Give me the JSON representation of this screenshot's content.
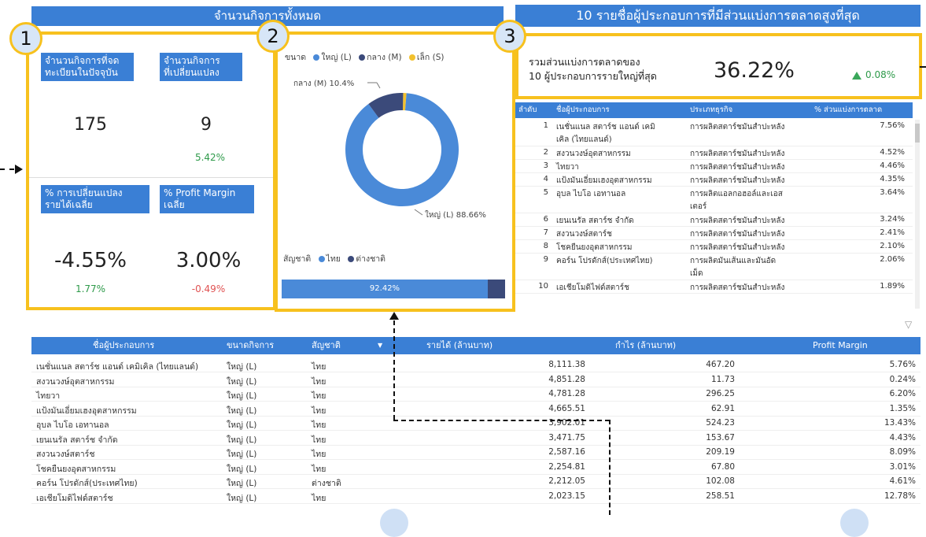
{
  "panel1": {
    "header": "จำนวนกิจการทั้งหมด",
    "kpi_registered_label": "จำนวนกิจการที่จด\nทะเบียนในปัจจุบัน",
    "kpi_registered_value": "175",
    "kpi_changed_label": "จำนวนกิจการ\nที่เปลี่ยนแปลง",
    "kpi_changed_value": "9",
    "kpi_changed_sub": "5.42%",
    "kpi_revchange_label": "% การเปลี่ยนแปลง\nรายได้เฉลี่ย",
    "kpi_revchange_value": "-4.55%",
    "kpi_revchange_sub": "1.77%",
    "kpi_margin_label": "% Profit Margin\nเฉลี่ย",
    "kpi_margin_value": "3.00%",
    "kpi_margin_sub": "-0.49%"
  },
  "panel2": {
    "size_legend_title": "ขนาด",
    "size_legend": [
      {
        "label": "ใหญ่ (L)",
        "color": "#4a8ad8"
      },
      {
        "label": "กลาง (M)",
        "color": "#3b4a7a"
      },
      {
        "label": "เล็ก (S)",
        "color": "#f2c12e"
      }
    ],
    "donut_label_m": "กลาง (M) 10.4%",
    "donut_label_l": "ใหญ่ (L) 88.66%",
    "nation_legend_title": "สัญชาติ",
    "nation_legend": [
      {
        "label": "ไทย",
        "color": "#4a8ad8"
      },
      {
        "label": "ต่างชาติ",
        "color": "#3b4a7a"
      }
    ],
    "bar_label": "92.42%"
  },
  "chart_data": [
    {
      "type": "pie",
      "categories": [
        "ใหญ่ (L)",
        "กลาง (M)",
        "เล็ก (S)"
      ],
      "values": [
        88.66,
        10.4,
        0.94
      ]
    },
    {
      "type": "bar",
      "categories": [
        "ไทย",
        "ต่างชาติ"
      ],
      "values": [
        92.42,
        7.58
      ]
    }
  ],
  "panel3": {
    "header": "10 รายชื่อผู้ประกอบการที่มีส่วนแบ่งการตลาดสูงที่สุด",
    "total_label": "รวมส่วนแบ่งการตลาดของ\n10 ผู้ประกอบการรายใหญ่ที่สุด",
    "total_value": "36.22%",
    "total_delta": "0.08%",
    "columns": [
      "ลำดับ",
      "ชื่อผู้ประกอบการ",
      "ประเภทธุรกิจ",
      "% ส่วนแบ่งการตลาด"
    ],
    "rows": [
      {
        "rank": "1",
        "name": "เนชั่นแนล สตาร์ช แอนด์ เคมิ",
        "name2": "เคิล (ไทยแลนด์)",
        "type": "การผลิตสตาร์ชมันสำปะหลัง",
        "type2": "",
        "share": "7.56%"
      },
      {
        "rank": "2",
        "name": "สงวนวงษ์อุตสาหกรรม",
        "name2": "",
        "type": "การผลิตสตาร์ชมันสำปะหลัง",
        "type2": "",
        "share": "4.52%"
      },
      {
        "rank": "3",
        "name": "ไทยวา",
        "name2": "",
        "type": "การผลิตสตาร์ชมันสำปะหลัง",
        "type2": "",
        "share": "4.46%"
      },
      {
        "rank": "4",
        "name": "แป้งมันเอี่ยมเฮงอุตสาหกรรม",
        "name2": "",
        "type": "การผลิตสตาร์ชมันสำปะหลัง",
        "type2": "",
        "share": "4.35%"
      },
      {
        "rank": "5",
        "name": "อุบล ไบโอ เอทานอล",
        "name2": "",
        "type": "การผลิตแอลกอฮอล์และเอส",
        "type2": "เตอร์",
        "share": "3.64%"
      },
      {
        "rank": "6",
        "name": "เยนเนรัล สตาร์ช จำกัด",
        "name2": "",
        "type": "การผลิตสตาร์ชมันสำปะหลัง",
        "type2": "",
        "share": "3.24%"
      },
      {
        "rank": "7",
        "name": "สงวนวงษ์สตาร์ช",
        "name2": "",
        "type": "การผลิตสตาร์ชมันสำปะหลัง",
        "type2": "",
        "share": "2.41%"
      },
      {
        "rank": "8",
        "name": "โชคยืนยงอุตสาหกรรม",
        "name2": "",
        "type": "การผลิตสตาร์ชมันสำปะหลัง",
        "type2": "",
        "share": "2.10%"
      },
      {
        "rank": "9",
        "name": "คอร์น โปรดักส์(ประเทศไทย)",
        "name2": "",
        "type": "การผลิตมันเส้นและมันอัด",
        "type2": "เม็ด",
        "share": "2.06%"
      },
      {
        "rank": "10",
        "name": "เอเชียโมดิไฟด์สตาร์ช",
        "name2": "",
        "type": "การผลิตสตาร์ชมันสำปะหลัง",
        "type2": "",
        "share": "1.89%"
      }
    ]
  },
  "bottom_table": {
    "columns": [
      "ชื่อผู้ประกอบการ",
      "ขนาดกิจการ",
      "สัญชาติ",
      "รายได้ (ล้านบาท)",
      "กำไร (ล้านบาท)",
      "Profit Margin"
    ],
    "rows": [
      [
        "เนชั่นแนล สตาร์ช แอนด์ เคมิเคิล (ไทยแลนด์)",
        "ใหญ่ (L)",
        "ไทย",
        "8,111.38",
        "467.20",
        "5.76%"
      ],
      [
        "สงวนวงษ์อุตสาหกรรม",
        "ใหญ่ (L)",
        "ไทย",
        "4,851.28",
        "11.73",
        "0.24%"
      ],
      [
        "ไทยวา",
        "ใหญ่ (L)",
        "ไทย",
        "4,781.28",
        "296.25",
        "6.20%"
      ],
      [
        "แป้งมันเอี่ยมเฮงอุตสาหกรรม",
        "ใหญ่ (L)",
        "ไทย",
        "4,665.51",
        "62.91",
        "1.35%"
      ],
      [
        "อุบล ไบโอ เอทานอล",
        "ใหญ่ (L)",
        "ไทย",
        "3,902.01",
        "524.23",
        "13.43%"
      ],
      [
        "เยนเนรัล สตาร์ช จำกัด",
        "ใหญ่ (L)",
        "ไทย",
        "3,471.75",
        "153.67",
        "4.43%"
      ],
      [
        "สงวนวงษ์สตาร์ช",
        "ใหญ่ (L)",
        "ไทย",
        "2,587.16",
        "209.19",
        "8.09%"
      ],
      [
        "โชคยืนยงอุตสาหกรรม",
        "ใหญ่ (L)",
        "ไทย",
        "2,254.81",
        "67.80",
        "3.01%"
      ],
      [
        "คอร์น โปรดักส์(ประเทศไทย)",
        "ใหญ่ (L)",
        "ต่างชาติ",
        "2,212.05",
        "102.08",
        "4.61%"
      ],
      [
        "เอเชียโมดิไฟด์สตาร์ช",
        "ใหญ่ (L)",
        "ไทย",
        "2,023.15",
        "258.51",
        "12.78%"
      ]
    ]
  },
  "markers": [
    "1",
    "2",
    "3"
  ]
}
